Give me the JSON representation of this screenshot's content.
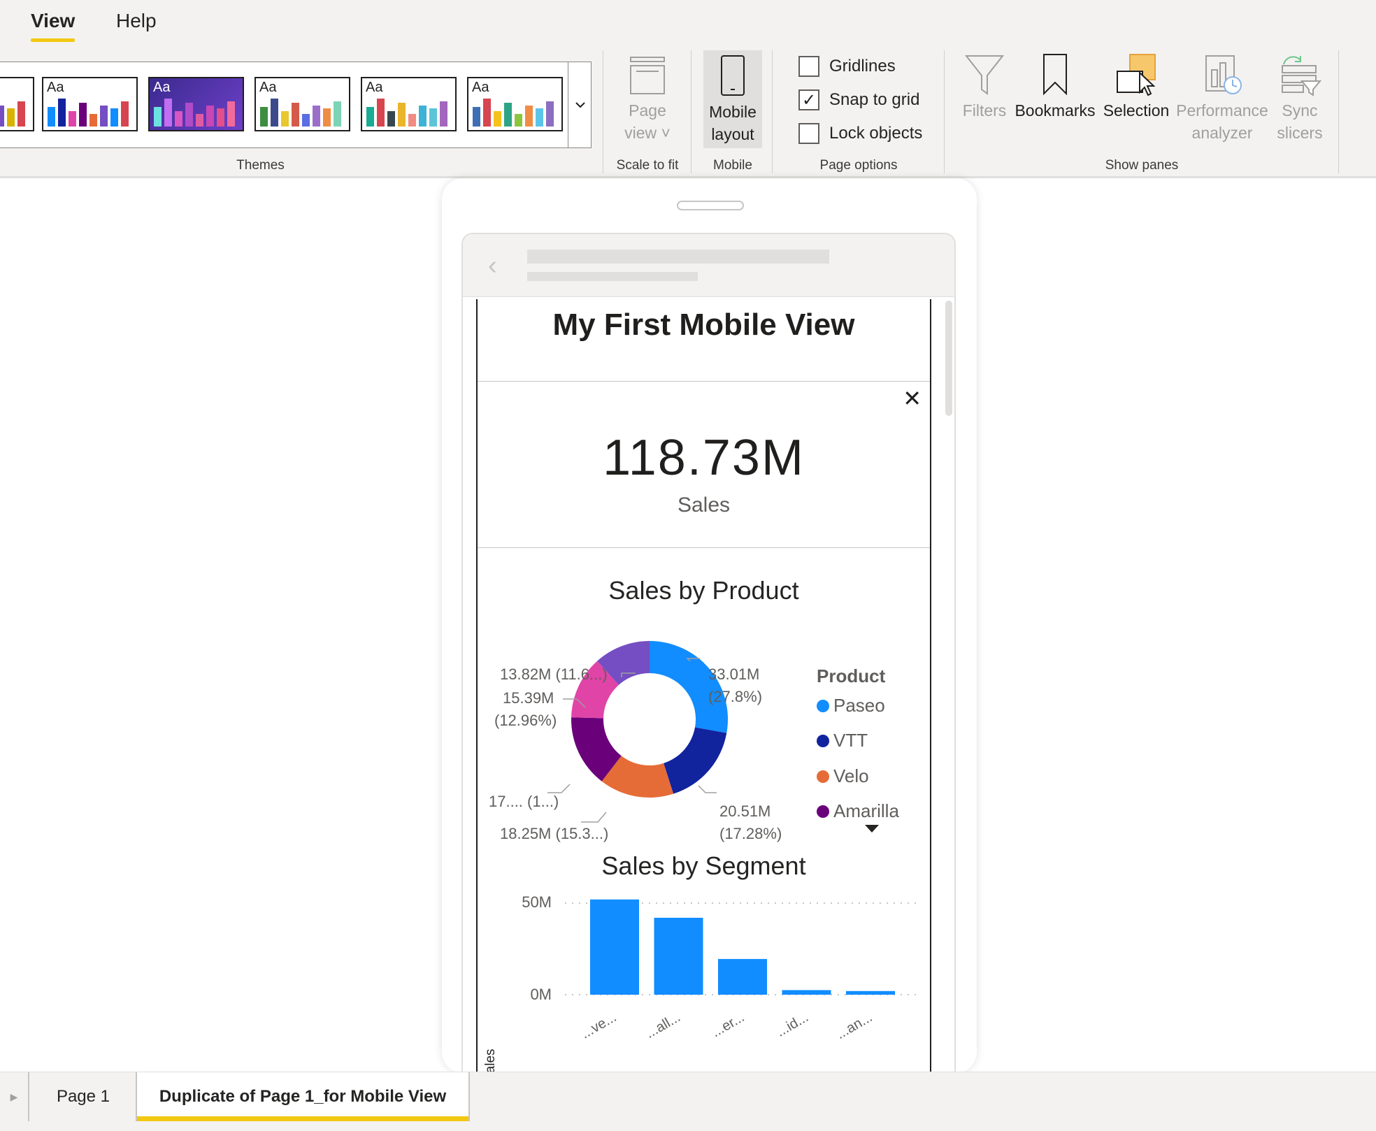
{
  "ribbon": {
    "tabs": [
      "View",
      "Help"
    ],
    "groups": {
      "themes": "Themes",
      "scale": "Scale to fit",
      "mobile": "Mobile",
      "page_options": "Page options",
      "show_panes": "Show panes"
    },
    "theme_swatches": [
      {
        "label": "Aa",
        "colors": [
          "#118dff",
          "#12239e",
          "#e66c37",
          "#6b007b",
          "#e044a7",
          "#744ec2",
          "#d9b300",
          "#d64550"
        ]
      },
      {
        "label": "Aa",
        "colors": [
          "#118dff",
          "#12239e",
          "#e044a7",
          "#6b007b",
          "#e66c37",
          "#744ec2",
          "#118dff",
          "#d64550"
        ]
      },
      {
        "label": "Aa",
        "colors": [
          "#6be1e0",
          "#c26ef2",
          "#d855c4",
          "#b04bc9",
          "#e05aa3",
          "#c847b5",
          "#e24f8a",
          "#f06a9b"
        ]
      },
      {
        "label": "Aa",
        "colors": [
          "#3e8e41",
          "#3c4a8c",
          "#e8c72f",
          "#d45b4a",
          "#5a6fe2",
          "#9b6fc9",
          "#ef8d45",
          "#7dd3b5"
        ]
      },
      {
        "label": "Aa",
        "colors": [
          "#1aab95",
          "#d64550",
          "#37474f",
          "#eab52a",
          "#f28b82",
          "#3cb3d6",
          "#5dc4d8",
          "#a266bc"
        ]
      },
      {
        "label": "Aa",
        "colors": [
          "#3e6fb5",
          "#d64550",
          "#f4c21b",
          "#2ea486",
          "#8cc63e",
          "#ef8d45",
          "#5dc4e9",
          "#8b6ec1"
        ]
      }
    ],
    "page_view": [
      "Page",
      "view"
    ],
    "mobile_layout": [
      "Mobile",
      "layout"
    ],
    "page_options": [
      {
        "label": "Gridlines",
        "checked": false
      },
      {
        "label": "Snap to grid",
        "checked": true
      },
      {
        "label": "Lock objects",
        "checked": false
      }
    ],
    "panes": {
      "filters": "Filters",
      "bookmarks": "Bookmarks",
      "selection": "Selection",
      "performance": [
        "Performance",
        "analyzer"
      ],
      "sync": [
        "Sync",
        "slicers"
      ]
    },
    "accent": "#f2c811"
  },
  "report": {
    "title": "My First Mobile View",
    "kpi": {
      "value": "118.73M",
      "label": "Sales"
    },
    "donut": {
      "title": "Sales by Product",
      "legend_title": "Product",
      "legend": [
        {
          "name": "Paseo",
          "color": "#118dff"
        },
        {
          "name": "VTT",
          "color": "#12239e"
        },
        {
          "name": "Velo",
          "color": "#e66c37"
        },
        {
          "name": "Amarilla",
          "color": "#6b007b"
        }
      ],
      "labels": {
        "top_right": [
          "33.01M",
          "(27.8%)"
        ],
        "bottom_right": [
          "20.51M",
          "(17.28%)"
        ],
        "bottom": "18.25M (15.3...)",
        "left_bottom": "17.... (1...)",
        "left_mid": [
          "15.39M",
          "(12.96%)"
        ],
        "top_left": "13.82M (11.6...)"
      }
    },
    "bar": {
      "title": "Sales by Segment",
      "ylabel": "Sales",
      "ticks": [
        "50M",
        "0M"
      ],
      "x_labels": [
        "...ve...",
        "...all...",
        "...er...",
        "...id...",
        "...an..."
      ]
    }
  },
  "chart_data": [
    {
      "type": "pie",
      "title": "Sales by Product",
      "categories": [
        "Paseo",
        "VTT",
        "Velo",
        "Amarilla",
        "",
        ""
      ],
      "values": [
        33.01,
        20.51,
        18.25,
        17.75,
        15.39,
        13.82
      ],
      "percentages": [
        27.8,
        17.28,
        15.3,
        14.9,
        12.96,
        11.6
      ],
      "colors": [
        "#118dff",
        "#12239e",
        "#e66c37",
        "#6b007b",
        "#e044a7",
        "#744ec2"
      ],
      "legend": "right"
    },
    {
      "type": "bar",
      "title": "Sales by Segment",
      "ylabel": "Sales",
      "categories": [
        "...ve...",
        "...all...",
        "...er...",
        "...id...",
        "...an..."
      ],
      "values": [
        52,
        42,
        19.5,
        2.5,
        2
      ],
      "ylim": [
        0,
        50
      ],
      "color": "#118dff",
      "grid": true
    }
  ],
  "pages": {
    "tabs": [
      "Page 1",
      "Duplicate of Page 1_for Mobile View"
    ],
    "active": 1
  }
}
